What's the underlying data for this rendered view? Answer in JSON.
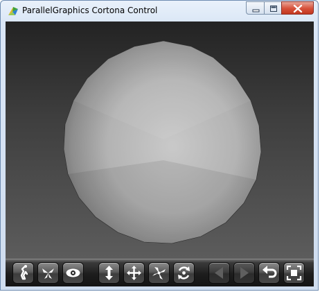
{
  "window": {
    "title": "ParallelGraphics Cortona Control",
    "app_icon": "cortona-logo-icon",
    "caption_buttons": [
      "minimize-icon",
      "maximize-icon",
      "close-icon"
    ]
  },
  "viewport": {
    "background_top": "#232323",
    "background_bottom": "#5c5c5c",
    "object": "grey-sphere"
  },
  "toolbar": {
    "groups": [
      [
        "walk-icon",
        "fly-icon",
        "study-icon"
      ],
      [
        "plan-icon",
        "pan-icon",
        "turn-icon",
        "roll-icon"
      ],
      [
        "previous-viewpoint-icon",
        "next-viewpoint-icon",
        "restore-icon",
        "fit-icon"
      ]
    ],
    "disabled": [
      "previous-viewpoint-icon",
      "next-viewpoint-icon"
    ]
  }
}
